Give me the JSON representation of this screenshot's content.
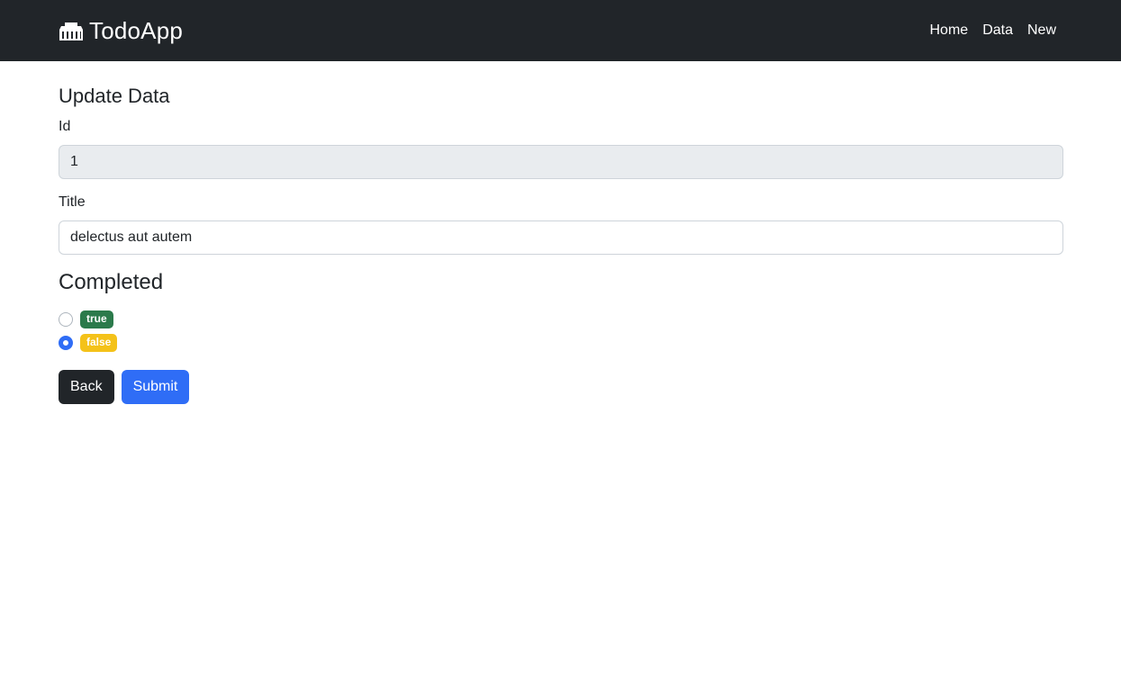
{
  "navbar": {
    "brand": "TodoApp",
    "brand_icon": "building-icon",
    "links": [
      "Home",
      "Data",
      "New"
    ]
  },
  "form": {
    "title": "Update Data",
    "id_label": "Id",
    "id_value": "1",
    "title_label": "Title",
    "title_value": "delectus aut autem",
    "completed_heading": "Completed",
    "options": [
      {
        "label": "true",
        "checked": false,
        "color": "#2b7a4b"
      },
      {
        "label": "false",
        "checked": true,
        "color": "#f4c219"
      }
    ],
    "back_label": "Back",
    "submit_label": "Submit"
  },
  "colors": {
    "navbar_bg": "#212529",
    "primary": "#2f6df6",
    "success": "#2b7a4b",
    "warning": "#f4c219",
    "readonly_bg": "#e9ecef"
  }
}
